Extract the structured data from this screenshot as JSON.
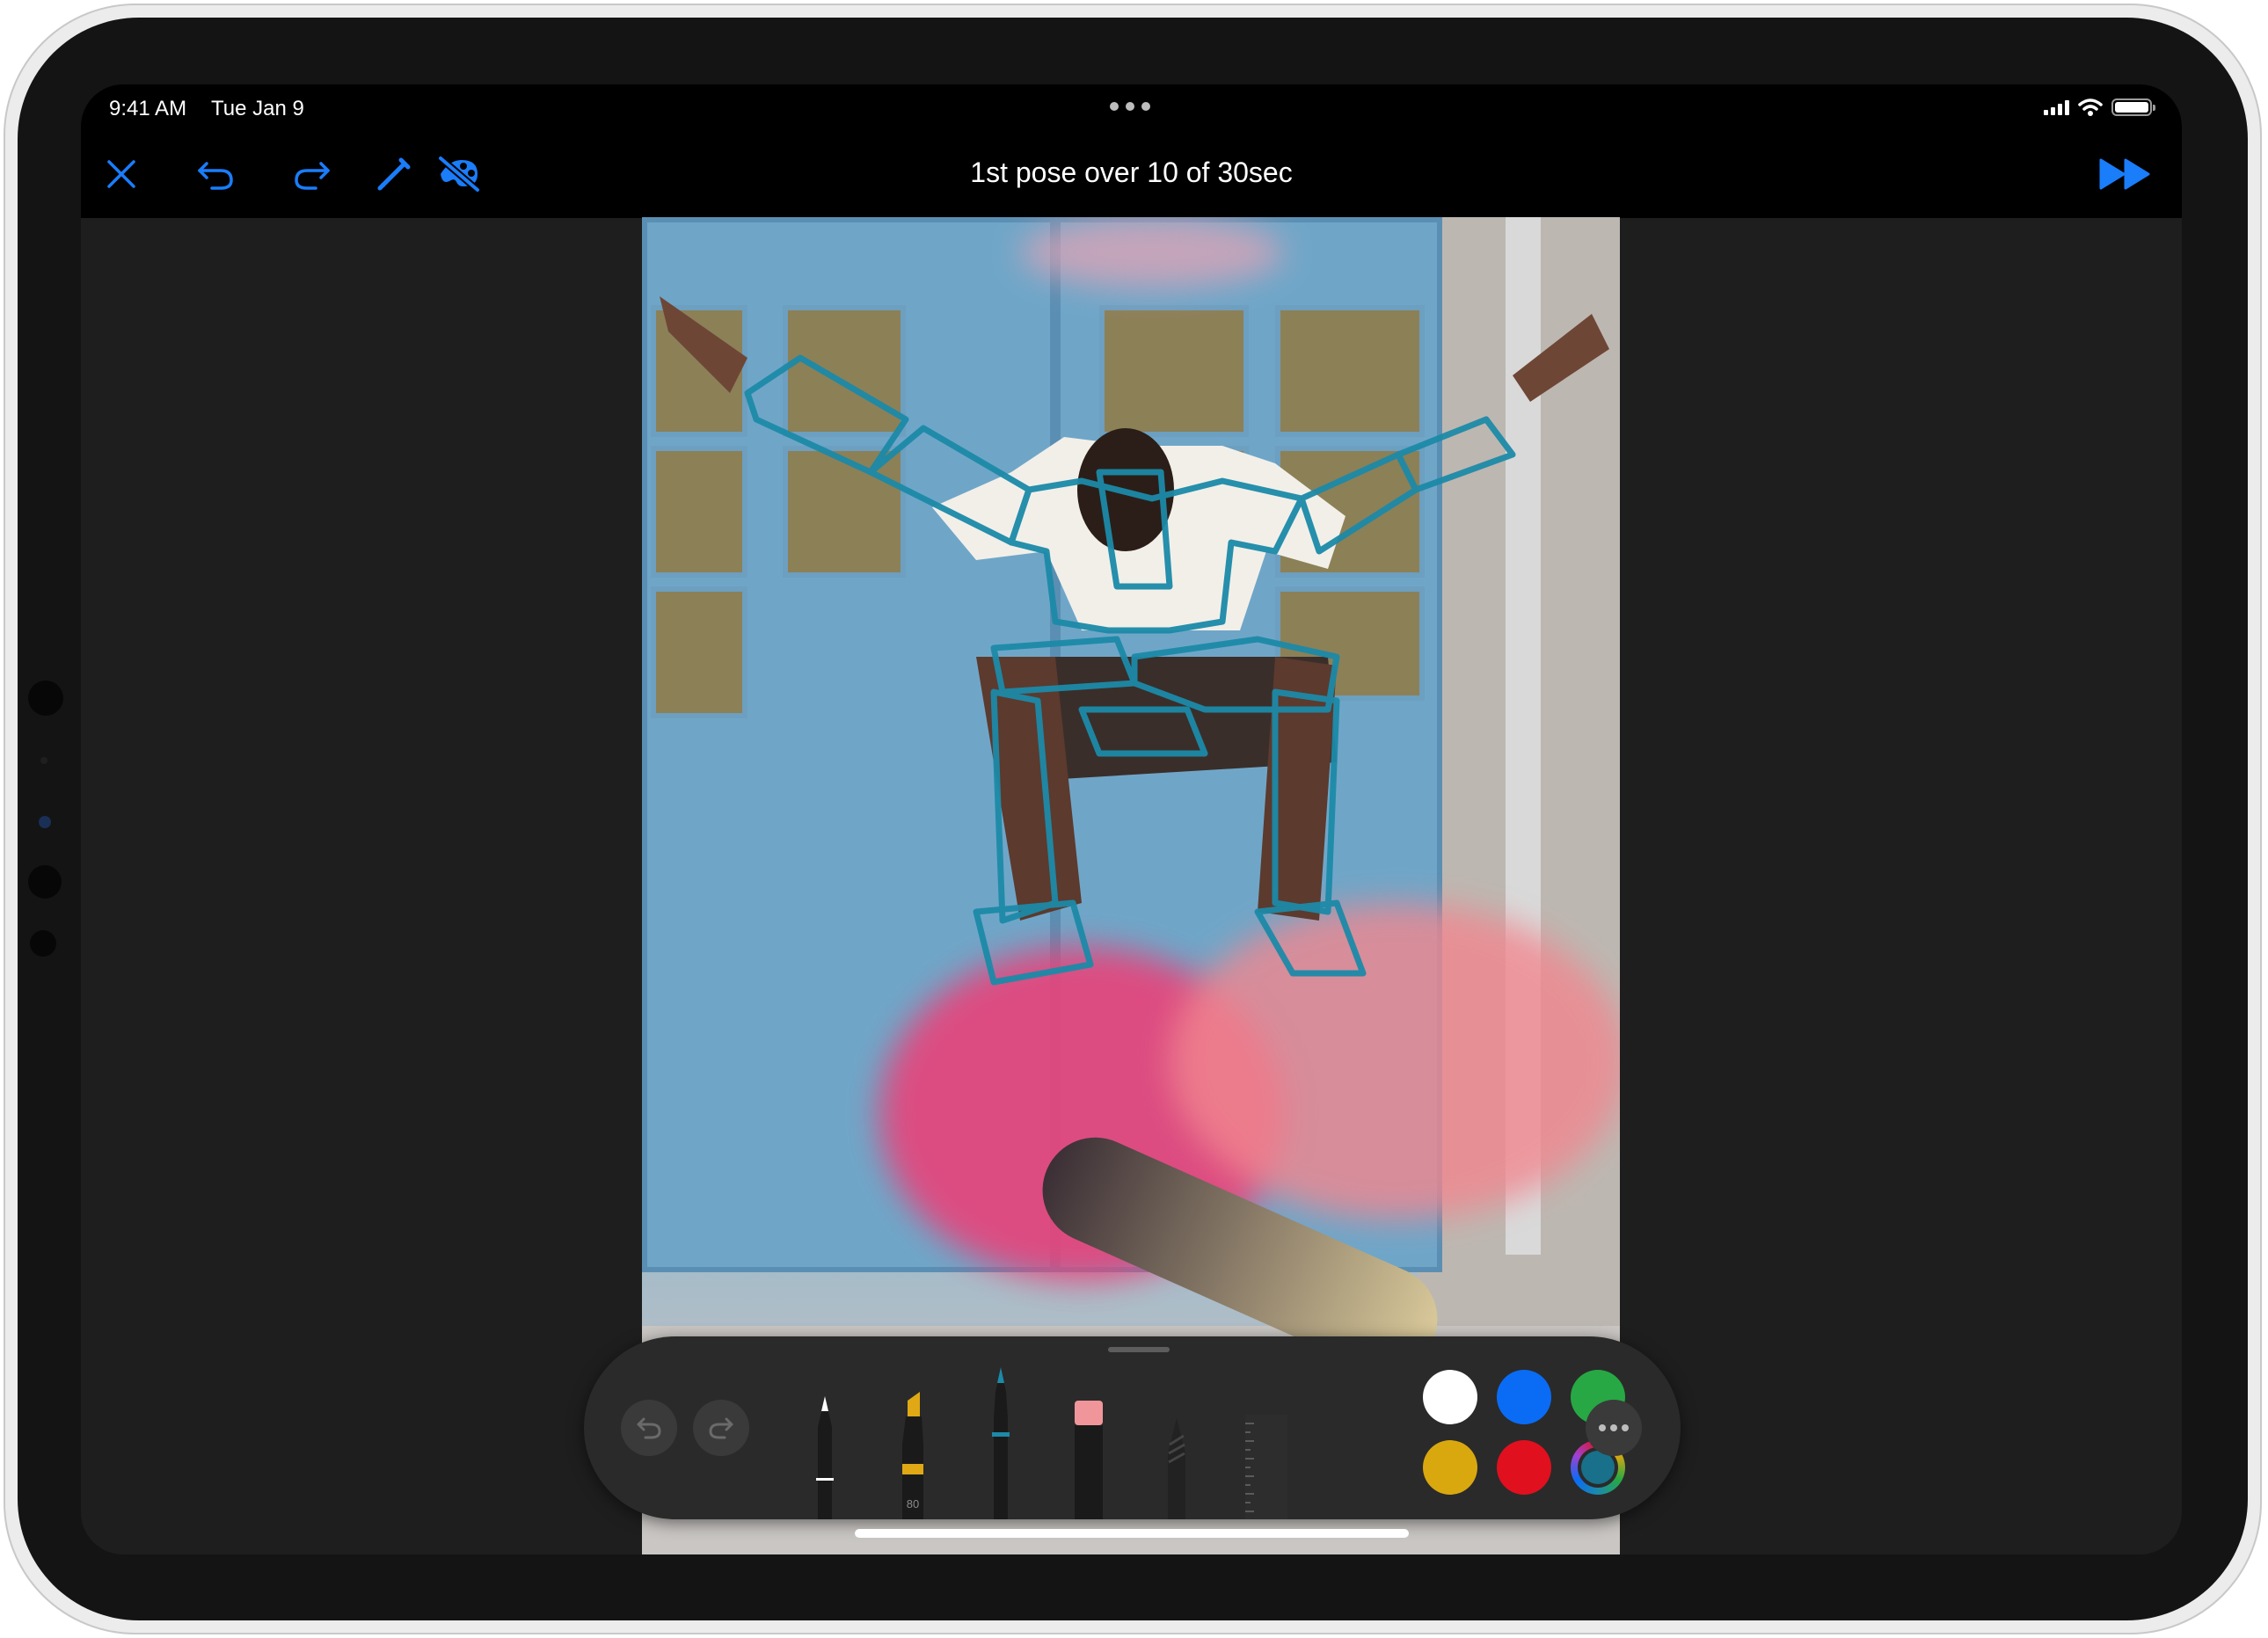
{
  "status_bar": {
    "time": "9:41 AM",
    "date": "Tue Jan 9"
  },
  "toolbar": {
    "title": "1st pose over 10 of 30sec",
    "accent_color": "#1a7dfa",
    "buttons": [
      "close-icon",
      "undo-icon",
      "redo-icon",
      "pencil-icon",
      "hide-reference-icon",
      "skip-forward-icon"
    ]
  },
  "palette": {
    "tools": [
      {
        "name": "pen",
        "label": ""
      },
      {
        "name": "marker",
        "label": "80"
      },
      {
        "name": "fountain-pen",
        "label": ""
      },
      {
        "name": "eraser",
        "label": ""
      },
      {
        "name": "pencil",
        "label": ""
      },
      {
        "name": "ruler",
        "label": ""
      }
    ],
    "colors": [
      "#ffffff",
      "#0a6cf5",
      "#27a844",
      "#d9a80f",
      "#e0101e",
      "#18708a"
    ],
    "selected_color": "#18708a"
  },
  "sketch_color": "#1c8aa8"
}
